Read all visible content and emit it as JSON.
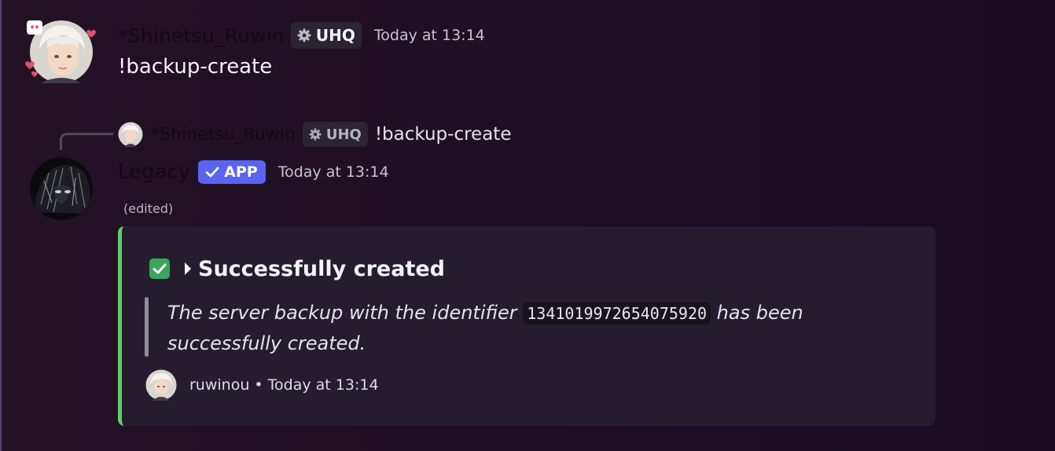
{
  "message1": {
    "username": "*Shinetsu_Ruwin",
    "tag": "UHQ",
    "timestamp": "Today at 13:14",
    "content": "!backup-create"
  },
  "reply": {
    "username": "*Shinetsu_Ruwin",
    "tag": "UHQ",
    "content": "!backup-create"
  },
  "message2": {
    "username": "Legacy",
    "badge": "APP",
    "timestamp": "Today at 13:14",
    "edited": "(edited)"
  },
  "embed": {
    "accent_color": "#5fd06a",
    "title": "Successfully created",
    "description_before": "The server backup with the identifier ",
    "identifier": "1341019972654075920",
    "description_after": " has been successfully created.",
    "footer": "ruwinou • Today at 13:14"
  },
  "colors": {
    "app_badge": "#5865f2",
    "success_check": "#3ba55d"
  },
  "icons": {
    "tag_icon": "gear-icon",
    "badge_icon": "checkmark-icon",
    "title_prefix": "check-box-icon",
    "title_caret": "caret-right-icon"
  }
}
